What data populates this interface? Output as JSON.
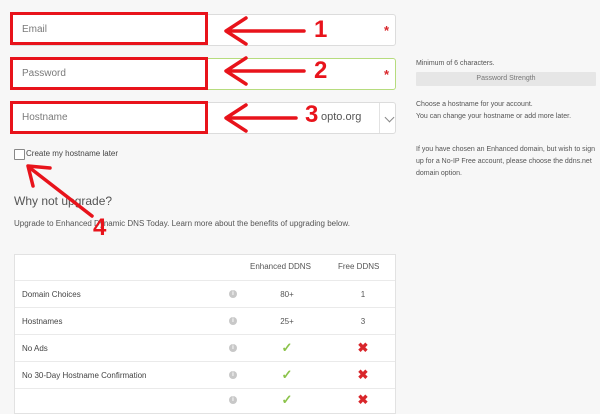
{
  "form": {
    "email_placeholder": "Email",
    "password_placeholder": "Password",
    "hostname_placeholder": "Hostname",
    "domain_value": "opto.org",
    "required_mark": "*",
    "create_later_label": "Create my hostname later"
  },
  "side": {
    "password_hint": "Minimum of 6 characters.",
    "password_strength": "Password Strength",
    "hostname_hint_1": "Choose a hostname for your account.",
    "hostname_hint_2": "You can change your hostname or add more later.",
    "enhanced_hint_1": "If you have chosen an Enhanced domain, but wish to sign",
    "enhanced_hint_2": "up for a No-IP Free account, please choose the ddns.net",
    "enhanced_hint_3": "domain option."
  },
  "upgrade": {
    "heading": "Why not upgrade?",
    "text": "Upgrade to Enhanced Dynamic DNS Today. Learn more about the benefits of upgrading below."
  },
  "table": {
    "headers": [
      "Enhanced DDNS",
      "Free DDNS"
    ],
    "rows": [
      {
        "label": "Domain Choices",
        "enhanced": "80+",
        "free": "1"
      },
      {
        "label": "Hostnames",
        "enhanced": "25+",
        "free": "3"
      },
      {
        "label": "No Ads",
        "enhanced": "✓",
        "free": "✖"
      },
      {
        "label": "No 30-Day Hostname Confirmation",
        "enhanced": "✓",
        "free": "✖"
      },
      {
        "label": "",
        "enhanced": "✓",
        "free": "✖"
      }
    ],
    "info_glyph": "i"
  },
  "annotations": {
    "n1": "1",
    "n2": "2",
    "n3": "3",
    "n4": "4",
    "color": "#e8131b"
  }
}
